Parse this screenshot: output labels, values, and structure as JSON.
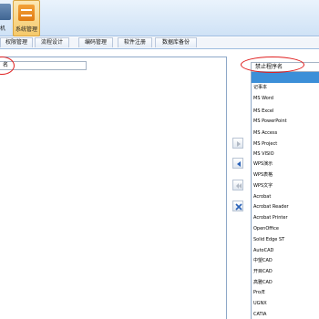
{
  "ribbon": {
    "buttons": [
      {
        "label": "机"
      },
      {
        "label": "系统管理"
      }
    ]
  },
  "tabs": [
    "权限管理",
    "流程设计",
    "编码管理",
    "软件注册",
    "数据库备份"
  ],
  "left": {
    "header": "名"
  },
  "right": {
    "header": "禁止程序名",
    "items": [
      "记事本",
      "MS Word",
      "MS Excel",
      "MS PowerPoint",
      "MS Access",
      "MS Project",
      "MS VISIO",
      "WPS演示",
      "WPS表格",
      "WPS文字",
      "Acrobat",
      "Acrobat Reader",
      "Acrobat Printer",
      "OpenOffice",
      "Solid Edge ST",
      "AutoCAD",
      "中望CAD",
      "开目CAD",
      "高雅CAD",
      "Pro/E",
      "UGNX",
      "CATIA"
    ]
  },
  "colors": {
    "selection": "#3c8fd8",
    "annotation": "#e02020",
    "ribbon": "#cfe2f6"
  }
}
